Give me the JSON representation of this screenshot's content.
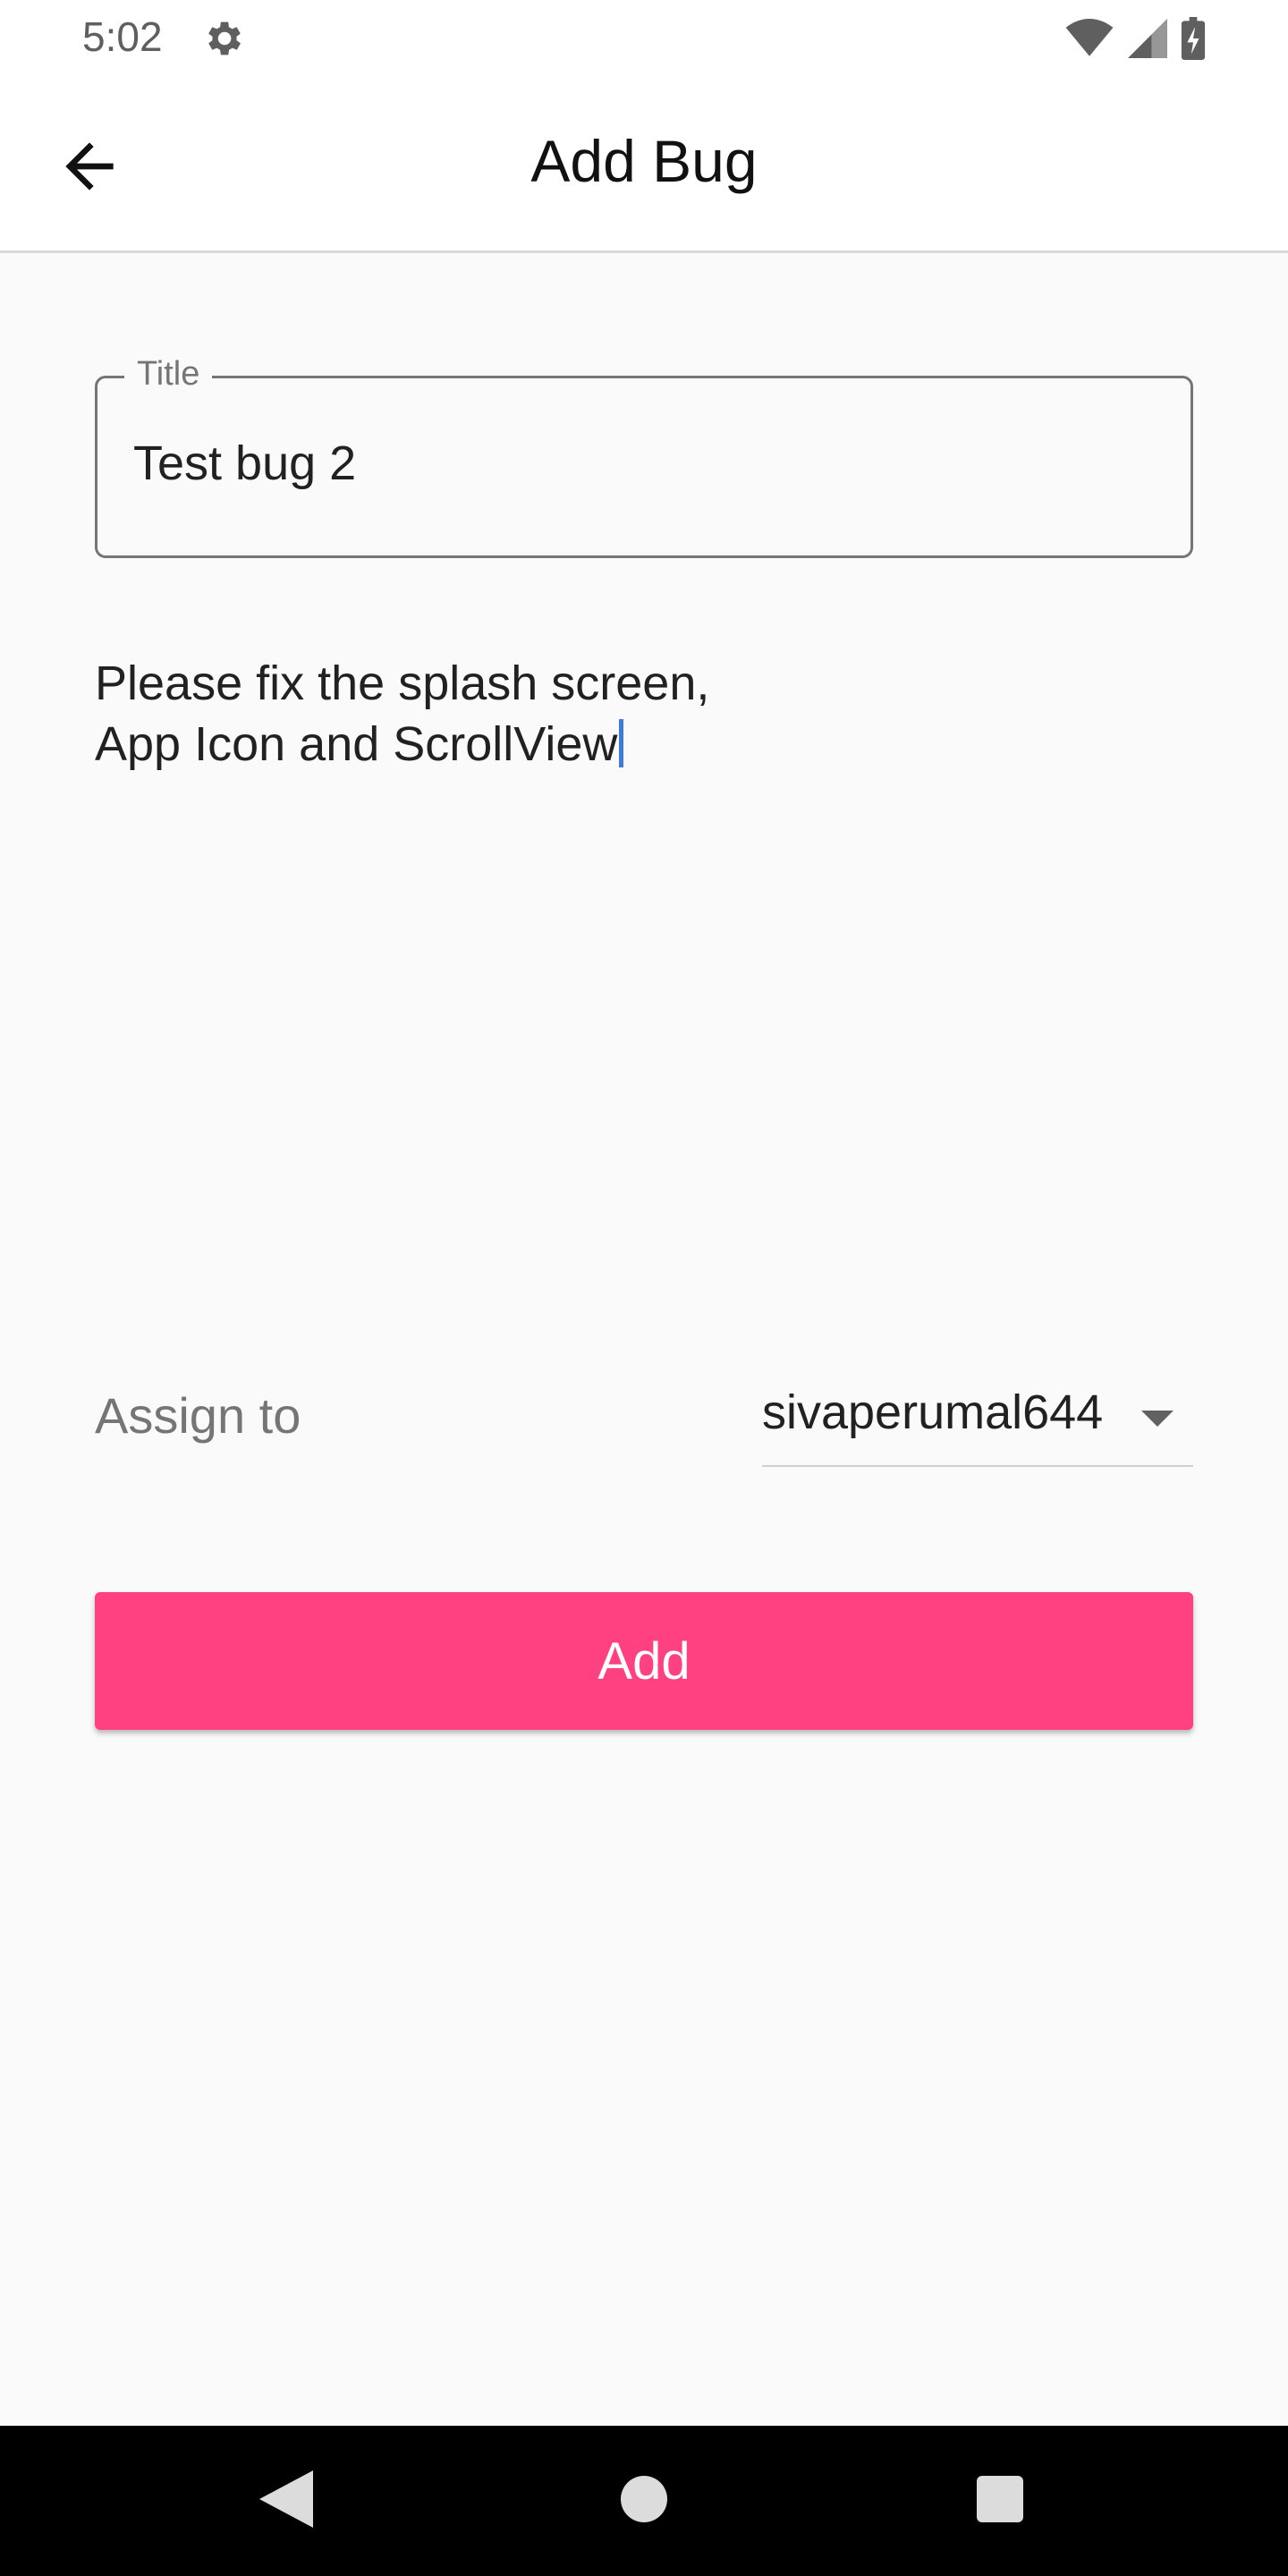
{
  "status_bar": {
    "time": "5:02",
    "icons": [
      "gear-icon",
      "wifi-icon",
      "signal-icon",
      "battery-icon"
    ]
  },
  "app_bar": {
    "title": "Add Bug",
    "back_icon": "arrow-left-icon"
  },
  "form": {
    "title_field": {
      "label": "Title",
      "value": "Test bug 2"
    },
    "description": {
      "line1": "Please fix the splash screen,",
      "line2": "App Icon and ScrollView"
    },
    "assign": {
      "label": "Assign to",
      "selected": "sivaperumal644"
    },
    "add_button": {
      "label": "Add"
    }
  },
  "colors": {
    "accent": "#ff4081",
    "cursor": "#3d7bdc",
    "background": "#fafafa"
  },
  "nav_bar": {
    "icons": [
      "back-triangle-icon",
      "home-circle-icon",
      "recents-square-icon"
    ]
  }
}
